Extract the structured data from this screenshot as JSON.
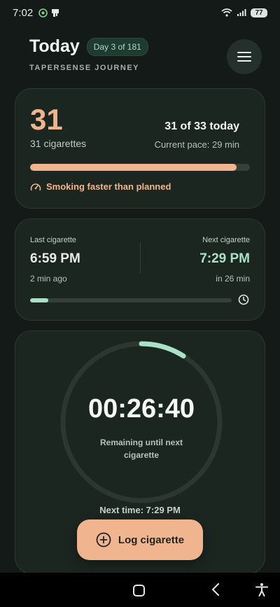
{
  "status": {
    "time": "7:02",
    "battery": "77"
  },
  "header": {
    "title": "Today",
    "day_pill": "Day 3 of 181",
    "subtitle": "TAPERSENSE JOURNEY"
  },
  "summary": {
    "count": "31",
    "count_label": "31 cigarettes",
    "today_text": "31 of 33 today",
    "pace_text": "Current pace: 29 min",
    "progress_fraction": 0.94,
    "warning": "Smoking faster than planned",
    "accent_color": "#f0b58e"
  },
  "schedule": {
    "last_label": "Last cigarette",
    "last_time": "6:59 PM",
    "last_ago": "2 min ago",
    "next_label": "Next cigarette",
    "next_time": "7:29 PM",
    "next_in": "in 26 min",
    "elapsed_fraction": 0.09,
    "accent_color": "#a8e1c7"
  },
  "timer": {
    "remaining": "00:26:40",
    "caption": "Remaining until next cigarette",
    "next_time_text": "Next time: 7:29 PM",
    "elapsed_fraction": 0.09
  },
  "actions": {
    "log_button": "Log cigarette"
  }
}
